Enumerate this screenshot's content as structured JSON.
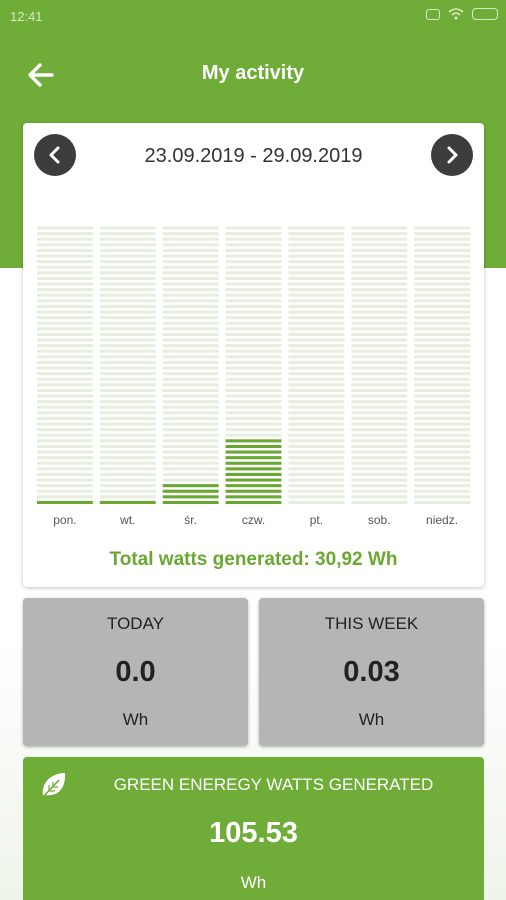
{
  "status_bar": {
    "time": "12:41"
  },
  "header": {
    "title": "My activity"
  },
  "chart": {
    "date_range": "23.09.2019 - 29.09.2019",
    "total_text": "Total watts generated: 30,92 Wh"
  },
  "chart_data": {
    "type": "bar",
    "categories": [
      "pon.",
      "wt.",
      "śr.",
      "czw.",
      "pt.",
      "sob.",
      "niedz."
    ],
    "values": [
      1,
      1,
      4,
      12,
      0,
      0,
      0
    ],
    "ylim": [
      0,
      50
    ],
    "title": "",
    "xlabel": "",
    "ylabel": "",
    "bar_color": "#6aa833",
    "empty_color": "#e6efdf",
    "grid": false
  },
  "today": {
    "label": "TODAY",
    "value": "0.0",
    "unit": "Wh"
  },
  "week": {
    "label": "THIS WEEK",
    "value": "0.03",
    "unit": "Wh"
  },
  "green_energy": {
    "label": "GREEN ENEREGY WATTS GENERATED",
    "value": "105.53",
    "unit": "Wh",
    "icon": "leaf-icon"
  },
  "colors": {
    "brand": "#6fad38",
    "accent_text": "#6aa833",
    "card_gray": "#b5b5b5",
    "dark": "#3d3d3d"
  }
}
